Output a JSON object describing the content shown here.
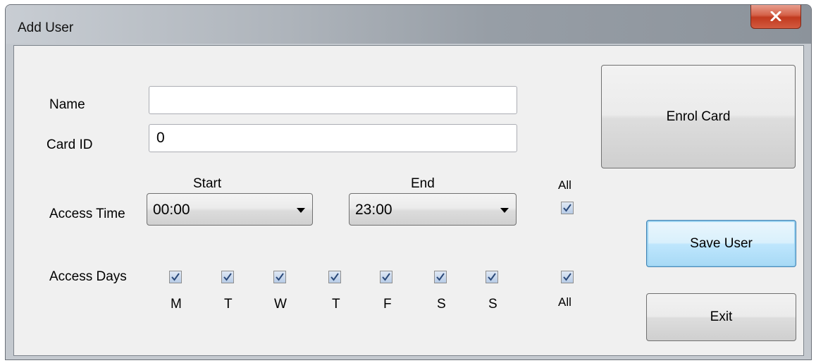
{
  "window": {
    "title": "Add User",
    "close_icon": "close-icon"
  },
  "form": {
    "name": {
      "label": "Name",
      "value": ""
    },
    "card_id": {
      "label": "Card ID",
      "value": "0"
    },
    "access_time": {
      "label": "Access Time",
      "start_header": "Start",
      "end_header": "End",
      "start_value": "00:00",
      "end_value": "23:00",
      "all_label": "All",
      "all_checked": true
    },
    "access_days": {
      "label": "Access Days",
      "days": [
        {
          "label": "M",
          "checked": true
        },
        {
          "label": "T",
          "checked": true
        },
        {
          "label": "W",
          "checked": true
        },
        {
          "label": "T",
          "checked": true
        },
        {
          "label": "F",
          "checked": true
        },
        {
          "label": "S",
          "checked": true
        },
        {
          "label": "S",
          "checked": true
        }
      ],
      "all_label": "All",
      "all_checked": true
    }
  },
  "buttons": {
    "enrol": "Enrol Card",
    "save": "Save User",
    "exit": "Exit"
  }
}
